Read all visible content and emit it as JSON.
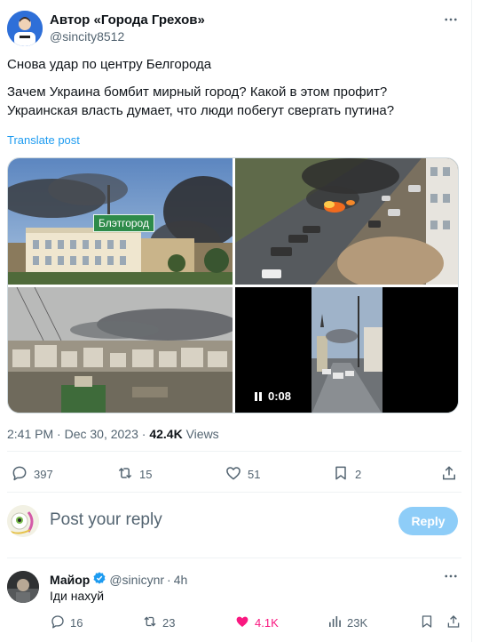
{
  "post": {
    "author_name": "Автор «Города Грехов»",
    "author_handle": "@sincity8512",
    "text_line1": "Снова удар по центру Белгорода",
    "text_line2": "Зачем Украина бомбит мирный город? Какой в этом профит?",
    "text_line3": "Украинская власть думает, что люди побегут свергать путина?",
    "translate_label": "Translate post",
    "media": {
      "photo1_sign": "Блэтгород",
      "video_duration": "0:08"
    },
    "time": "2:41 PM",
    "separator": "·",
    "date": "Dec 30, 2023",
    "views_count": "42.4K",
    "views_label": "Views",
    "stats": {
      "replies": "397",
      "reposts": "15",
      "likes": "51",
      "bookmarks": "2"
    }
  },
  "reply_box": {
    "placeholder": "Post your reply",
    "button_label": "Reply"
  },
  "comment": {
    "author_name": "Майор",
    "author_handle": "@sinicynr",
    "separator": "·",
    "time": "4h",
    "text": "Іди нахуй",
    "stats": {
      "replies": "16",
      "reposts": "23",
      "likes": "4.1K",
      "views": "23K"
    }
  },
  "colors": {
    "accent": "#1d9bf0",
    "reply_button": "#8ecdf8",
    "like_active": "#f91880",
    "verified": "#1d9bf0",
    "secondary_text": "#536471"
  },
  "icons": [
    "more-icon",
    "reply-icon",
    "repost-icon",
    "like-icon",
    "bookmark-icon",
    "share-icon",
    "verified-icon",
    "views-icon",
    "pause-icon"
  ]
}
